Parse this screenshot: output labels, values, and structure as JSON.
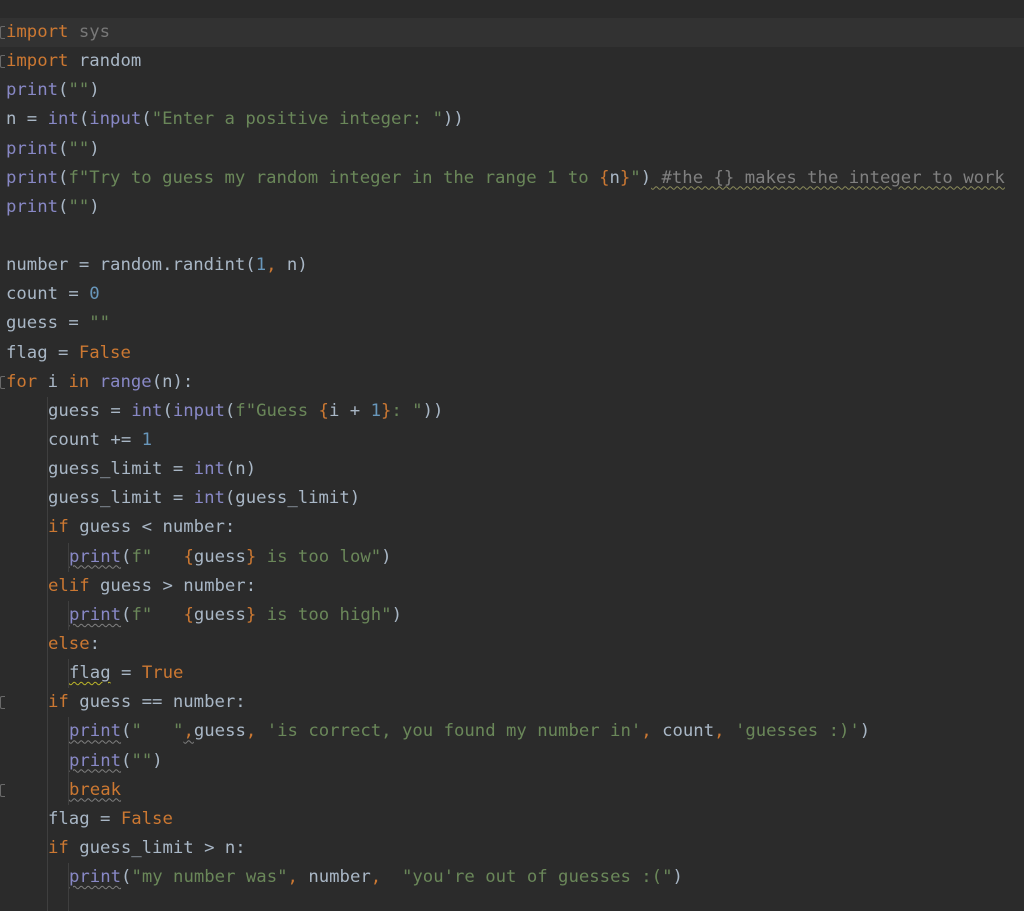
{
  "lines": [
    {
      "indent": 0,
      "gutter": "fold",
      "tokens": [
        [
          "kw",
          "import"
        ],
        [
          "t",
          " "
        ],
        [
          "dim",
          "sys"
        ]
      ]
    },
    {
      "indent": 0,
      "gutter": "fold",
      "tokens": [
        [
          "kw",
          "import"
        ],
        [
          "t",
          " random"
        ]
      ]
    },
    {
      "indent": 0,
      "tokens": [
        [
          "bi",
          "print"
        ],
        [
          "t",
          "("
        ],
        [
          "str",
          "\"\""
        ],
        [
          "t",
          ")"
        ]
      ]
    },
    {
      "indent": 0,
      "tokens": [
        [
          "t",
          "n = "
        ],
        [
          "bi",
          "int"
        ],
        [
          "t",
          "("
        ],
        [
          "bi",
          "input"
        ],
        [
          "t",
          "("
        ],
        [
          "str",
          "\"Enter a positive integer: \""
        ],
        [
          "t",
          "))"
        ]
      ]
    },
    {
      "indent": 0,
      "tokens": [
        [
          "bi",
          "print"
        ],
        [
          "t",
          "("
        ],
        [
          "str",
          "\"\""
        ],
        [
          "t",
          ")"
        ]
      ]
    },
    {
      "indent": 0,
      "tokens": [
        [
          "bi",
          "print"
        ],
        [
          "t",
          "("
        ],
        [
          "str",
          "f\"Try to guess my random integer in the range 1 to "
        ],
        [
          "kw",
          "{"
        ],
        [
          "t",
          "n"
        ],
        [
          "kw",
          "}"
        ],
        [
          "str",
          "\""
        ],
        [
          "t",
          ")"
        ],
        [
          "sq-cm",
          " #the {} makes the integer to work"
        ]
      ]
    },
    {
      "indent": 0,
      "tokens": [
        [
          "bi",
          "print"
        ],
        [
          "t",
          "("
        ],
        [
          "str",
          "\"\""
        ],
        [
          "t",
          ")"
        ]
      ]
    },
    {
      "indent": 0,
      "tokens": []
    },
    {
      "indent": 0,
      "tokens": [
        [
          "t",
          "number = random.randint("
        ],
        [
          "num",
          "1"
        ],
        [
          "kw",
          ","
        ],
        [
          "t",
          " n)"
        ]
      ]
    },
    {
      "indent": 0,
      "tokens": [
        [
          "t",
          "count = "
        ],
        [
          "num",
          "0"
        ]
      ]
    },
    {
      "indent": 0,
      "tokens": [
        [
          "t",
          "guess = "
        ],
        [
          "str",
          "\"\""
        ]
      ]
    },
    {
      "indent": 0,
      "tokens": [
        [
          "t",
          "flag = "
        ],
        [
          "kw",
          "False"
        ]
      ]
    },
    {
      "indent": 0,
      "gutter": "fold",
      "tokens": [
        [
          "kw",
          "for"
        ],
        [
          "t",
          " i "
        ],
        [
          "kw",
          "in"
        ],
        [
          "t",
          " "
        ],
        [
          "bi",
          "range"
        ],
        [
          "t",
          "(n):"
        ]
      ]
    },
    {
      "indent": 1,
      "tokens": [
        [
          "t",
          "guess = "
        ],
        [
          "bi",
          "int"
        ],
        [
          "t",
          "("
        ],
        [
          "bi",
          "input"
        ],
        [
          "t",
          "("
        ],
        [
          "str",
          "f\"Guess "
        ],
        [
          "kw",
          "{"
        ],
        [
          "t",
          "i + "
        ],
        [
          "num",
          "1"
        ],
        [
          "kw",
          "}"
        ],
        [
          "str",
          ": \""
        ],
        [
          "t",
          "))"
        ]
      ]
    },
    {
      "indent": 1,
      "tokens": [
        [
          "t",
          "count += "
        ],
        [
          "num",
          "1"
        ]
      ]
    },
    {
      "indent": 1,
      "tokens": [
        [
          "t",
          "guess_limit = "
        ],
        [
          "bi",
          "int"
        ],
        [
          "t",
          "(n)"
        ]
      ]
    },
    {
      "indent": 1,
      "tokens": [
        [
          "t",
          "guess_limit = "
        ],
        [
          "bi",
          "int"
        ],
        [
          "t",
          "(guess_limit)"
        ]
      ]
    },
    {
      "indent": 1,
      "tokens": [
        [
          "kw",
          "if"
        ],
        [
          "t",
          " guess < number:"
        ]
      ]
    },
    {
      "indent": 2,
      "tokens": [
        [
          "sq-bi",
          "print"
        ],
        [
          "t",
          "("
        ],
        [
          "str",
          "f\"   "
        ],
        [
          "kw",
          "{"
        ],
        [
          "t",
          "guess"
        ],
        [
          "kw",
          "}"
        ],
        [
          "str",
          " is too low\""
        ],
        [
          "t",
          ")"
        ]
      ]
    },
    {
      "indent": 1,
      "tokens": [
        [
          "kw",
          "elif"
        ],
        [
          "t",
          " guess > number:"
        ]
      ]
    },
    {
      "indent": 2,
      "tokens": [
        [
          "sq-bi",
          "print"
        ],
        [
          "t",
          "("
        ],
        [
          "str",
          "f\"   "
        ],
        [
          "kw",
          "{"
        ],
        [
          "t",
          "guess"
        ],
        [
          "kw",
          "}"
        ],
        [
          "str",
          " is too high\""
        ],
        [
          "t",
          ")"
        ]
      ]
    },
    {
      "indent": 1,
      "tokens": [
        [
          "kw",
          "else"
        ],
        [
          "t",
          ":"
        ]
      ]
    },
    {
      "indent": 2,
      "tokens": [
        [
          "sq",
          "flag"
        ],
        [
          "t",
          " = "
        ],
        [
          "kw",
          "True"
        ]
      ]
    },
    {
      "indent": 1,
      "gutter": "fold",
      "tokens": [
        [
          "kw",
          "if"
        ],
        [
          "t",
          " guess == number:"
        ]
      ]
    },
    {
      "indent": 2,
      "tokens": [
        [
          "sq-bi",
          "print"
        ],
        [
          "t",
          "("
        ],
        [
          "str",
          "\"   \""
        ],
        [
          "sq-kw",
          ","
        ],
        [
          "t",
          "guess"
        ],
        [
          "kw",
          ","
        ],
        [
          "t",
          " "
        ],
        [
          "str",
          "'is correct, you found my number in'"
        ],
        [
          "kw",
          ","
        ],
        [
          "t",
          " count"
        ],
        [
          "kw",
          ","
        ],
        [
          "t",
          " "
        ],
        [
          "str",
          "'guesses :)'"
        ],
        [
          "t",
          ")"
        ]
      ]
    },
    {
      "indent": 2,
      "tokens": [
        [
          "sq-bi",
          "print"
        ],
        [
          "t",
          "("
        ],
        [
          "str",
          "\"\""
        ],
        [
          "t",
          ")"
        ]
      ]
    },
    {
      "indent": 2,
      "gutter": "fold",
      "tokens": [
        [
          "sq-kw",
          "break"
        ]
      ]
    },
    {
      "indent": 1,
      "tokens": [
        [
          "t",
          "flag = "
        ],
        [
          "kw",
          "False"
        ]
      ]
    },
    {
      "indent": 1,
      "tokens": [
        [
          "kw",
          "if"
        ],
        [
          "t",
          " guess_limit > n:"
        ]
      ]
    },
    {
      "indent": 2,
      "tokens": [
        [
          "sq-bi",
          "print"
        ],
        [
          "t",
          "("
        ],
        [
          "str",
          "\"my number was\""
        ],
        [
          "kw",
          ","
        ],
        [
          "t",
          " number"
        ],
        [
          "kw",
          ","
        ],
        [
          "t",
          "  "
        ],
        [
          "str",
          "\"you're out of guesses :(\""
        ],
        [
          "t",
          ")"
        ]
      ]
    },
    {
      "indent": 2,
      "tokens": []
    }
  ],
  "colors": {
    "background": "#2b2b2b",
    "current_line": "#323232",
    "text": "#a9b7c6",
    "keyword": "#cc7832",
    "builtin": "#8888c6",
    "string": "#6a8759",
    "number": "#6897bb",
    "comment": "#808080",
    "warning_underline": "#bbb529"
  },
  "icons": {
    "fold_marker": "fold-marker-icon"
  }
}
